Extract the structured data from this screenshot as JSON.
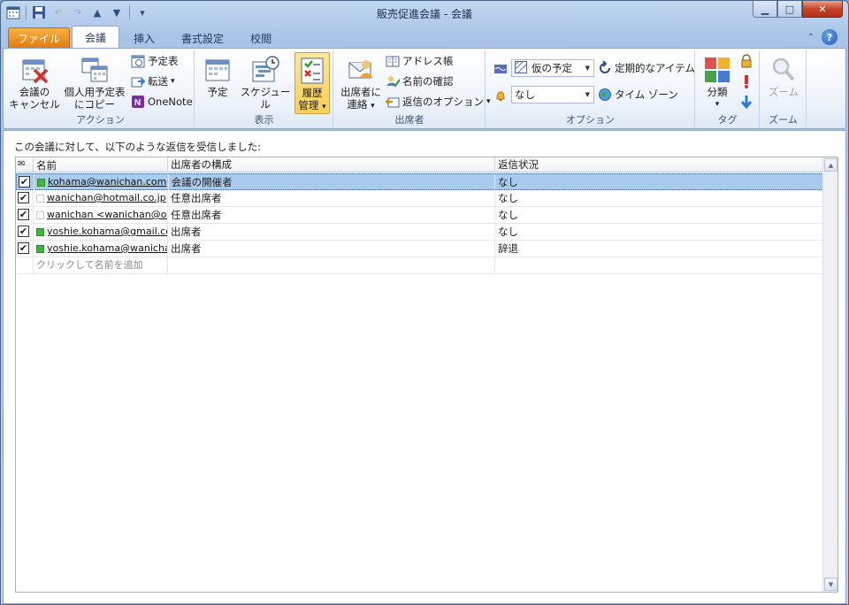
{
  "window": {
    "title": "販売促進会議 - 会議",
    "buttons": {
      "minimize": "▁",
      "maximize": "□",
      "close": "✕"
    }
  },
  "tabs": {
    "file": "ファイル",
    "meeting": "会議",
    "insert": "挿入",
    "format": "書式設定",
    "review": "校閲"
  },
  "ribbon": {
    "action": {
      "label": "アクション",
      "cancel_line1": "会議の",
      "cancel_line2": "キャンセル",
      "copy_line1": "個人用予定表",
      "copy_line2": "にコピー",
      "calendar": "予定表",
      "forward": "転送",
      "onenote": "OneNote"
    },
    "show": {
      "label": "表示",
      "appointment": "予定",
      "scheduling": "スケジュール",
      "tracking_line1": "履歴",
      "tracking_line2": "管理"
    },
    "attendees": {
      "label": "出席者",
      "contact_line1": "出席者に",
      "contact_line2": "連絡",
      "address_book": "アドレス帳",
      "check_names": "名前の確認",
      "response_options": "返信のオプション"
    },
    "options": {
      "label": "オプション",
      "show_as": "仮の予定",
      "reminder": "なし",
      "recurrence": "定期的なアイテム",
      "time_zones": "タイム ゾーン"
    },
    "tags": {
      "label": "タグ",
      "categorize": "分類"
    },
    "zoom": {
      "label": "ズーム",
      "zoom": "ズーム"
    }
  },
  "content": {
    "info": "この会議に対して、以下のような返信を受信しました:",
    "headers": {
      "name": "名前",
      "attendance": "出席者の構成",
      "response": "返信状況"
    },
    "rows": [
      {
        "checked": true,
        "name": "kohama@wanichan.com",
        "attendance": "会議の開催者",
        "response": "なし",
        "color": "#3db83d",
        "selected": true
      },
      {
        "checked": true,
        "name": "wanichan@hotmail.co.jp",
        "attendance": "任意出席者",
        "response": "なし",
        "color": "#ffffff",
        "selected": false
      },
      {
        "checked": true,
        "name": "wanichan <wanichan@outlo",
        "attendance": "任意出席者",
        "response": "なし",
        "color": "#ffffff",
        "selected": false
      },
      {
        "checked": true,
        "name": "yoshie.kohama@gmail.com",
        "attendance": "出席者",
        "response": "なし",
        "color": "#3db83d",
        "selected": false
      },
      {
        "checked": true,
        "name": "yoshie.kohama@wanichan.jp",
        "attendance": "出席者",
        "response": "辞退",
        "color": "#3db83d",
        "selected": false
      }
    ],
    "add_placeholder": "クリックして名前を追加"
  },
  "colors": {
    "selected_row": "#a9cbee",
    "file_tab": "#e98b1a",
    "highlight": "#fbd66a"
  },
  "icons": {
    "check": "✔",
    "dropdown": "▾"
  }
}
